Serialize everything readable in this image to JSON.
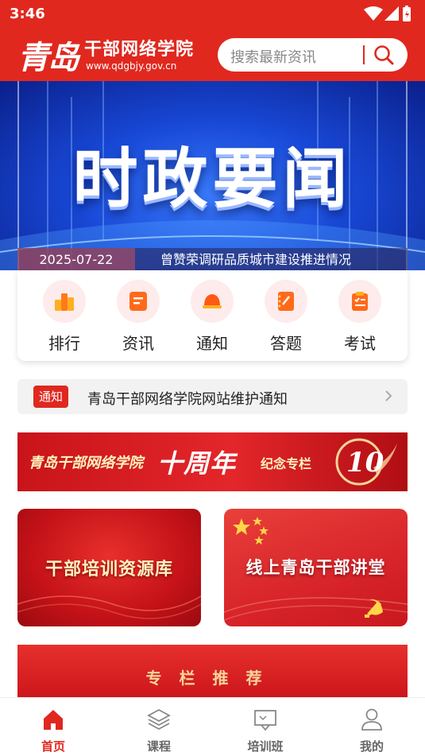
{
  "status_bar": {
    "time": "3:46"
  },
  "header": {
    "logo_city": "青岛",
    "logo_name": "干部网络学院",
    "logo_url": "www.qdgbjy.gov.cn",
    "search_placeholder": "搜索最新资讯"
  },
  "banner": {
    "title": "时政要闻",
    "date": "2025-07-22",
    "headline": "曾赞荣调研品质城市建设推进情况"
  },
  "quick_menu": [
    {
      "label": "排行",
      "icon": "ranking-icon"
    },
    {
      "label": "资讯",
      "icon": "news-icon"
    },
    {
      "label": "通知",
      "icon": "bell-icon"
    },
    {
      "label": "答题",
      "icon": "quiz-icon"
    },
    {
      "label": "考试",
      "icon": "exam-icon"
    }
  ],
  "notice": {
    "tag": "通知",
    "text": "青岛干部网络学院网站维护通知"
  },
  "anniversary_banner": {
    "part1": "青岛干部网络学院",
    "part2": "十周年",
    "part3": "纪念专栏",
    "number": "10"
  },
  "cards": [
    {
      "title": "干部培训资源库"
    },
    {
      "title": "线上青岛干部讲堂"
    }
  ],
  "recommend": {
    "title": "专栏推荐"
  },
  "tabbar": [
    {
      "label": "首页",
      "icon": "home-icon",
      "active": true
    },
    {
      "label": "课程",
      "icon": "layers-icon",
      "active": false
    },
    {
      "label": "培训班",
      "icon": "class-icon",
      "active": false
    },
    {
      "label": "我的",
      "icon": "user-icon",
      "active": false
    }
  ],
  "colors": {
    "brand_red": "#e0281f",
    "banner_blue": "#1848d6"
  }
}
